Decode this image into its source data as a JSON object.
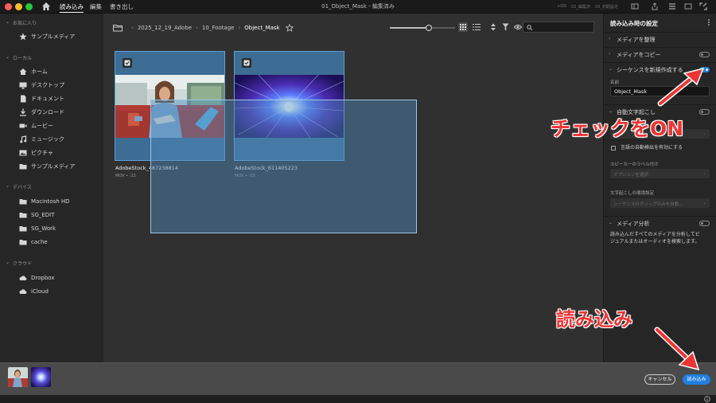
{
  "window": {
    "title": "01_Object_Mask - 編集済み",
    "menu": [
      "読み込み",
      "編集",
      "書き出し"
    ],
    "right_status": [
      "+ON",
      "02_編集済",
      "03_初期設定"
    ]
  },
  "sidebar": {
    "sections": [
      {
        "title": "お気に入り",
        "items": [
          {
            "label": "サンプルメディア",
            "icon": "star-icon"
          }
        ]
      },
      {
        "title": "ローカル",
        "items": [
          {
            "label": "ホーム",
            "icon": "home-icon"
          },
          {
            "label": "デスクトップ",
            "icon": "desktop-icon"
          },
          {
            "label": "ドキュメント",
            "icon": "document-icon"
          },
          {
            "label": "ダウンロード",
            "icon": "download-icon"
          },
          {
            "label": "ムービー",
            "icon": "movie-icon"
          },
          {
            "label": "ミュージック",
            "icon": "music-icon"
          },
          {
            "label": "ピクチャ",
            "icon": "picture-icon"
          },
          {
            "label": "サンプルメディア",
            "icon": "folder-icon"
          }
        ]
      },
      {
        "title": "デバイス",
        "items": [
          {
            "label": "Macintosh HD",
            "icon": "folder-icon"
          },
          {
            "label": "SG_EDIT",
            "icon": "folder-icon"
          },
          {
            "label": "SG_Work",
            "icon": "folder-icon"
          },
          {
            "label": "cache",
            "icon": "folder-icon"
          }
        ]
      },
      {
        "title": "クラウド",
        "items": [
          {
            "label": "Dropbox",
            "icon": "cloud-icon"
          },
          {
            "label": "iCloud",
            "icon": "cloud-icon"
          }
        ]
      }
    ]
  },
  "breadcrumb": [
    "2025_12_19_Adobe",
    "10_Footage",
    "Object_Mask"
  ],
  "thumbnail_zoom": 0.6,
  "media": [
    {
      "name": "AdobeStock_487238814",
      "meta": "MOV • :22"
    },
    {
      "name": "AdobeStock_611405223",
      "meta": "MOV • :03"
    }
  ],
  "panel": {
    "title": "読み込み時の設定",
    "sections": {
      "organize": "メディアを整理",
      "copy": "メディアをコピー",
      "sequence": "シーケンスを新規作成する",
      "name_label": "名前",
      "name_value": "Object_Mask",
      "captions": "自動文字起こし",
      "language_detect": "言語の自動検出を有効にする",
      "speaker_label": "スピーカーのラベル付け",
      "speaker_option": "オプションを選択",
      "caption_pref_label": "文字起こしの環境設定",
      "caption_pref_option": "シーケンスのクリップのみを自動...",
      "media_analysis": "メディア分析",
      "media_analysis_desc_1": "読み込んだすべてのメディアを分析してビ",
      "media_analysis_desc_2": "ジュアルまたはオーディオを検索します。"
    },
    "toggles": {
      "copy": false,
      "sequence": true,
      "captions": false,
      "media_analysis": false
    }
  },
  "buttons": {
    "cancel": "キャンセル",
    "import": "読み込み"
  },
  "annotations": {
    "check_on": "チェックをON",
    "import": "読み込み",
    "color": "#ee3434"
  },
  "colors": {
    "accent": "#1f7fe0",
    "selection": "#3d6c94"
  }
}
